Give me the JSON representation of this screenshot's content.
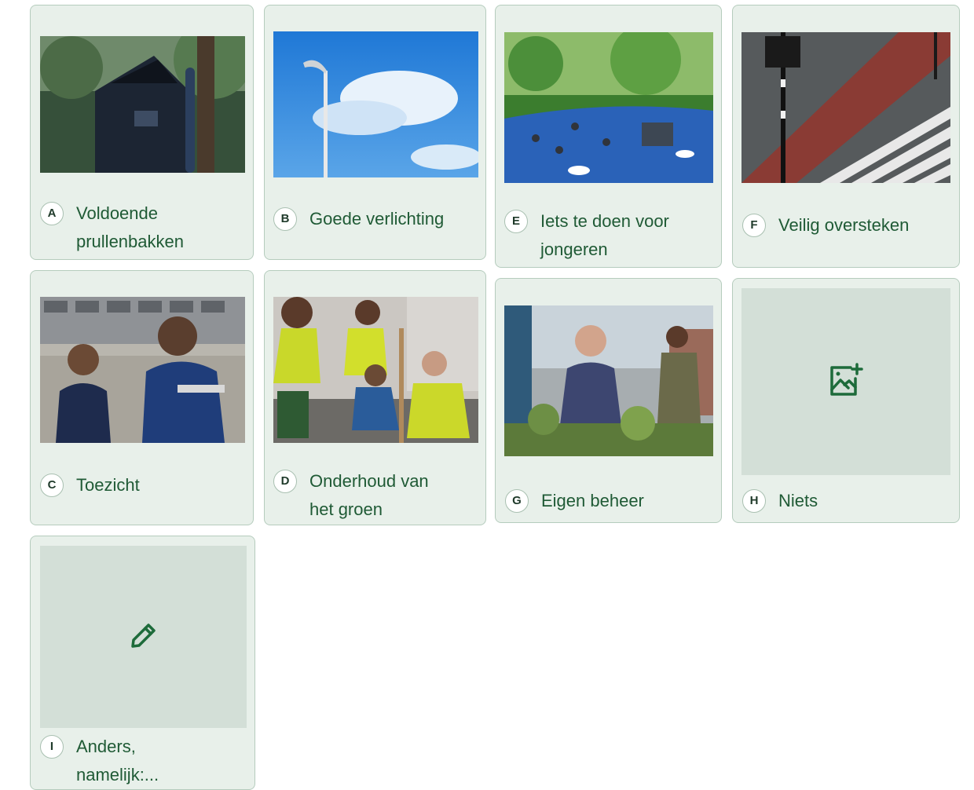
{
  "options": [
    {
      "letter": "A",
      "label": "Voldoende prullenbakken"
    },
    {
      "letter": "B",
      "label": "Goede verlichting"
    },
    {
      "letter": "E",
      "label": "Iets te doen voor jongeren"
    },
    {
      "letter": "F",
      "label": "Veilig oversteken"
    },
    {
      "letter": "C",
      "label": "Toezicht"
    },
    {
      "letter": "D",
      "label": "Onderhoud van het groen"
    },
    {
      "letter": "G",
      "label": "Eigen beheer"
    },
    {
      "letter": "H",
      "label": "Niets"
    },
    {
      "letter": "I",
      "label": "Anders, namelijk:..."
    }
  ],
  "icons": {
    "add_image": "image-plus-icon",
    "edit": "pencil-icon"
  },
  "colors": {
    "card_background": "#e8f0ea",
    "card_border": "#b5ccbd",
    "text": "#1f5a35",
    "icon": "#1d6b3a",
    "placeholder": "#d3dfd7"
  }
}
